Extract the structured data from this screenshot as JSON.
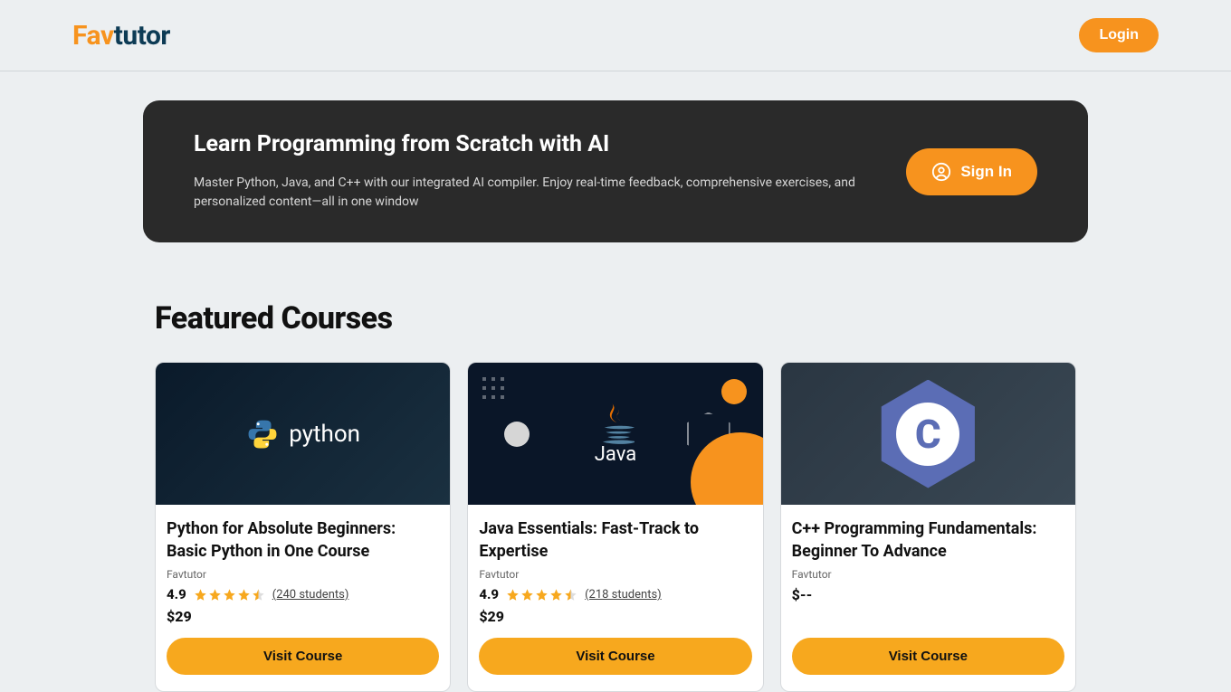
{
  "header": {
    "logo_fa": "Fa",
    "logo_v": "v",
    "logo_tutor": "tutor",
    "login_label": "Login"
  },
  "hero": {
    "title": "Learn Programming from Scratch with AI",
    "description": "Master Python, Java, and C++ with our integrated AI compiler. Enjoy real-time feedback, comprehensive exercises, and personalized content—all in one window",
    "signin_label": "Sign In"
  },
  "section_title": "Featured Courses",
  "courses": [
    {
      "title_bold": "Python for Absolute Beginners:",
      "title_sub": " Basic Python in One Course",
      "provider": "Favtutor",
      "rating": "4.9",
      "students": "(240 students)",
      "price": "$29",
      "visit_label": "Visit Course",
      "logo_text": "python"
    },
    {
      "title_bold": "Java Essentials:",
      "title_sub": " Fast-Track to Expertise",
      "provider": "Favtutor",
      "rating": "4.9",
      "students": "(218 students)",
      "price": "$29",
      "visit_label": "Visit Course",
      "logo_text": "Java"
    },
    {
      "title_bold": "C++ Programming Fundamentals:",
      "title_sub": " Beginner To Advance",
      "provider": "Favtutor",
      "rating": "",
      "students": "",
      "price": "$--",
      "visit_label": "Visit Course",
      "logo_text": "C"
    }
  ]
}
